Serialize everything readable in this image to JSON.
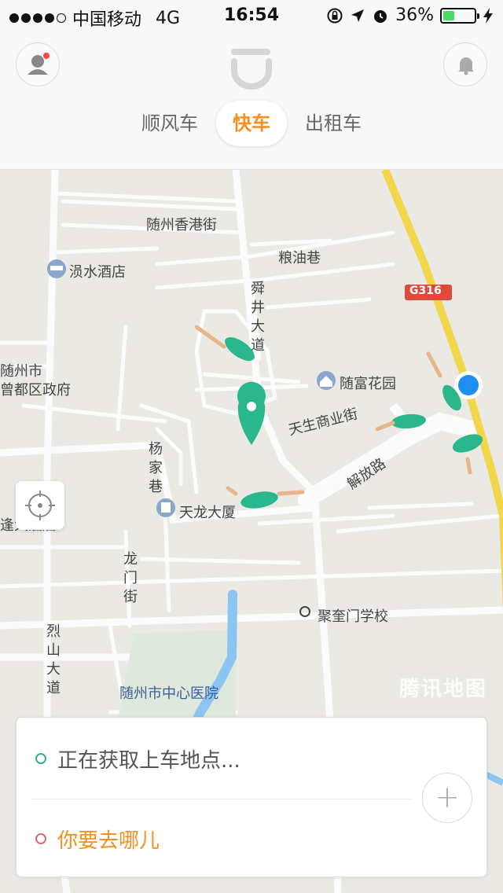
{
  "status_bar": {
    "carrier": "中国移动",
    "network": "4G",
    "time": "16:54",
    "battery_percent": "36%",
    "battery_level": 0.36
  },
  "header": {
    "tabs": [
      {
        "label": "顺风车",
        "active": false
      },
      {
        "label": "快车",
        "active": true
      },
      {
        "label": "出租车",
        "active": false
      }
    ],
    "accent_color": "#f5901e"
  },
  "map": {
    "labels": {
      "suizhou_hk_street": "随州香港街",
      "liangyou_lane": "粮油巷",
      "yunshui_hotel": "涢水酒店",
      "shunjing_avenue": "舜井大道",
      "highway_badge": "G316",
      "suizhou_city": "随州市",
      "zengdu_gov": "曾都区政府",
      "suifu_garden": "随富花园",
      "tiansheng_street": "天生商业街",
      "yangjia_lane": "杨家巷",
      "jiefang_road": "解放路",
      "tianlong_building": "天龙大厦",
      "big_hotel": "逢大酒店",
      "longmen_street": "龙门街",
      "jukuimen_school": "聚奎门学校",
      "lie_street": "烈山大道",
      "central_hospital": "随州市中心医院",
      "watermark": "腾讯地图"
    }
  },
  "trip": {
    "pickup_text": "正在获取上车地点...",
    "destination_text": "你要去哪儿",
    "add_label": "+"
  }
}
